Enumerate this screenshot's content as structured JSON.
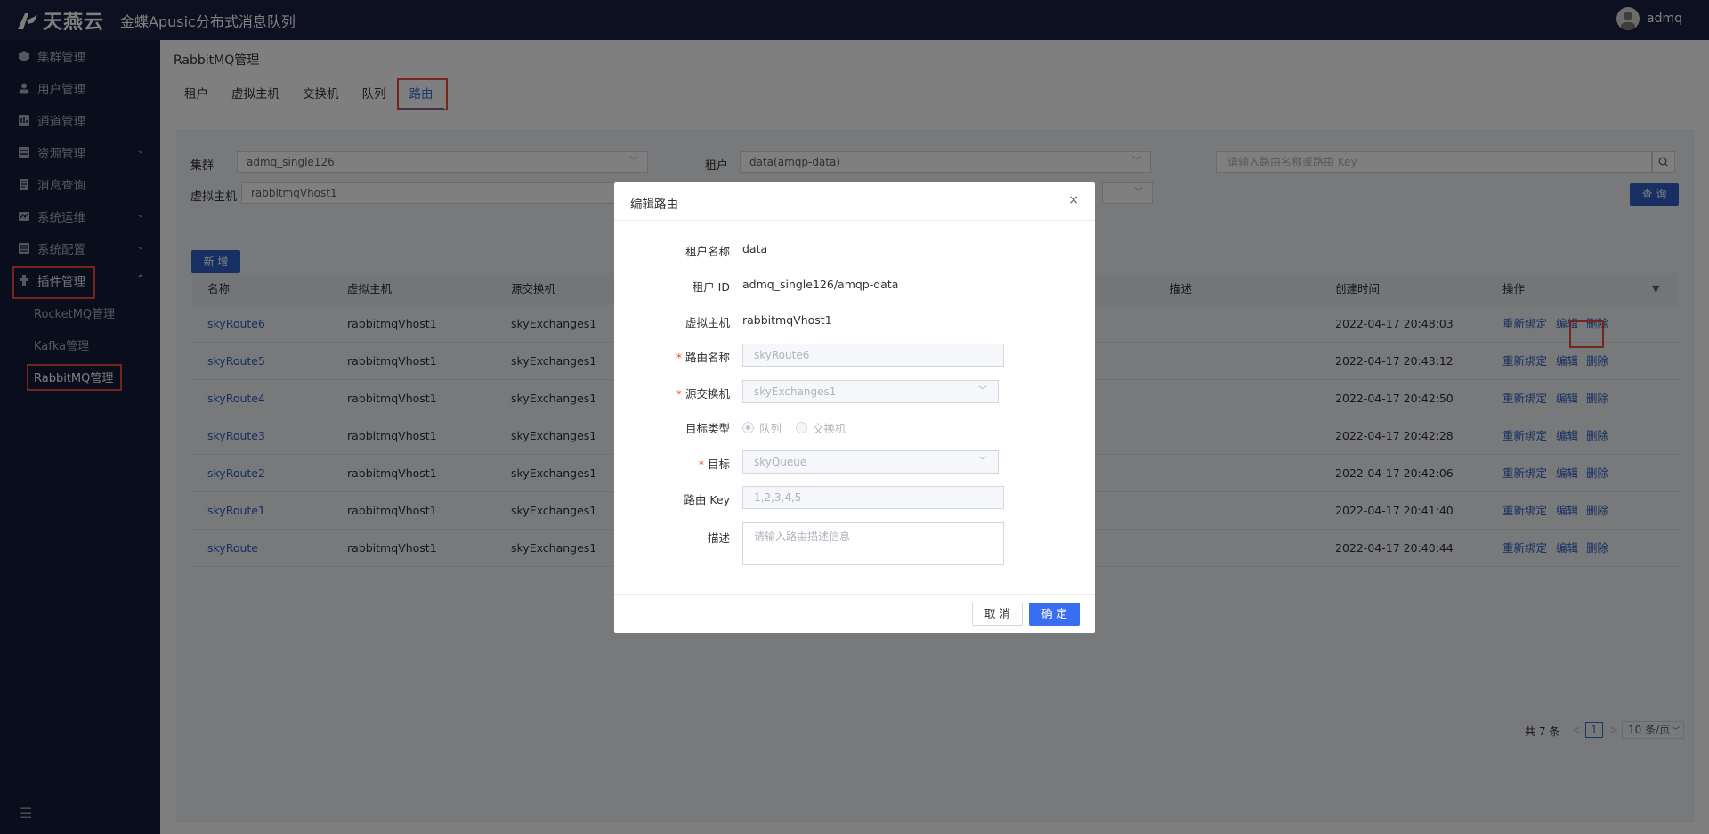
{
  "header": {
    "brand": "天燕云",
    "app_title": "金蝶Apusic分布式消息队列",
    "user": "admq"
  },
  "sidebar": {
    "items": [
      {
        "label": "集群管理",
        "icon": "cube-icon"
      },
      {
        "label": "用户管理",
        "icon": "user-icon"
      },
      {
        "label": "通道管理",
        "icon": "channel-icon"
      },
      {
        "label": "资源管理",
        "icon": "resource-icon",
        "chevron": "⌄"
      },
      {
        "label": "消息查询",
        "icon": "message-search-icon"
      },
      {
        "label": "系统运维",
        "icon": "ops-icon",
        "chevron": "⌄"
      },
      {
        "label": "系统配置",
        "icon": "config-icon",
        "chevron": "⌄"
      },
      {
        "label": "插件管理",
        "icon": "plugin-icon",
        "chevron": "⌃"
      }
    ],
    "subitems": [
      "RocketMQ管理",
      "Kafka管理",
      "RabbitMQ管理"
    ],
    "collapse_icon": "☰"
  },
  "page": {
    "title": "RabbitMQ管理",
    "tabs": [
      "租户",
      "虚拟主机",
      "交换机",
      "队列",
      "路由"
    ]
  },
  "filter": {
    "cluster_label": "集群",
    "cluster_value": "admq_single126",
    "tenant_label": "租户",
    "tenant_value": "data(amqp-data)",
    "vhost_label": "虚拟主机",
    "vhost_value": "rabbitmqVhost1",
    "search_placeholder": "请输入路由名称或路由 Key",
    "query_label": "查 询"
  },
  "table": {
    "add_label": "新 增",
    "columns": [
      "名称",
      "虚拟主机",
      "源交换机",
      "描述",
      "创建时间",
      "操作"
    ],
    "ops": [
      "重新绑定",
      "编辑",
      "删除"
    ],
    "rows": [
      {
        "name": "skyRoute6",
        "vhost": "rabbitmqVhost1",
        "exchange": "skyExchanges1",
        "time": "2022-04-17 20:48:03"
      },
      {
        "name": "skyRoute5",
        "vhost": "rabbitmqVhost1",
        "exchange": "skyExchanges1",
        "time": "2022-04-17 20:43:12"
      },
      {
        "name": "skyRoute4",
        "vhost": "rabbitmqVhost1",
        "exchange": "skyExchanges1",
        "time": "2022-04-17 20:42:50"
      },
      {
        "name": "skyRoute3",
        "vhost": "rabbitmqVhost1",
        "exchange": "skyExchanges1",
        "time": "2022-04-17 20:42:28"
      },
      {
        "name": "skyRoute2",
        "vhost": "rabbitmqVhost1",
        "exchange": "skyExchanges1",
        "time": "2022-04-17 20:42:06"
      },
      {
        "name": "skyRoute1",
        "vhost": "rabbitmqVhost1",
        "exchange": "skyExchanges1",
        "time": "2022-04-17 20:41:40"
      },
      {
        "name": "skyRoute",
        "vhost": "rabbitmqVhost1",
        "exchange": "skyExchanges1",
        "time": "2022-04-17 20:40:44"
      }
    ],
    "pager": {
      "total": "共 7 条",
      "prev": "<",
      "page": "1",
      "next": ">",
      "size": "10 条/页"
    }
  },
  "modal": {
    "title": "编辑路由",
    "close": "×",
    "tenant_name_label": "租户名称",
    "tenant_name": "data",
    "tenant_id_label": "租户 ID",
    "tenant_id": "admq_single126/amqp-data",
    "vhost_label": "虚拟主机",
    "vhost": "rabbitmqVhost1",
    "route_name_label": "路由名称",
    "route_name": "skyRoute6",
    "src_exchange_label": "源交换机",
    "src_exchange": "skyExchanges1",
    "target_type_label": "目标类型",
    "target_type_queue": "队列",
    "target_type_exchange": "交换机",
    "target_label": "目标",
    "target": "skyQueue",
    "route_key_label": "路由 Key",
    "route_key": "1,2,3,4,5",
    "desc_label": "描述",
    "desc_placeholder": "请输入路由描述信息",
    "cancel": "取 消",
    "ok": "确 定"
  }
}
